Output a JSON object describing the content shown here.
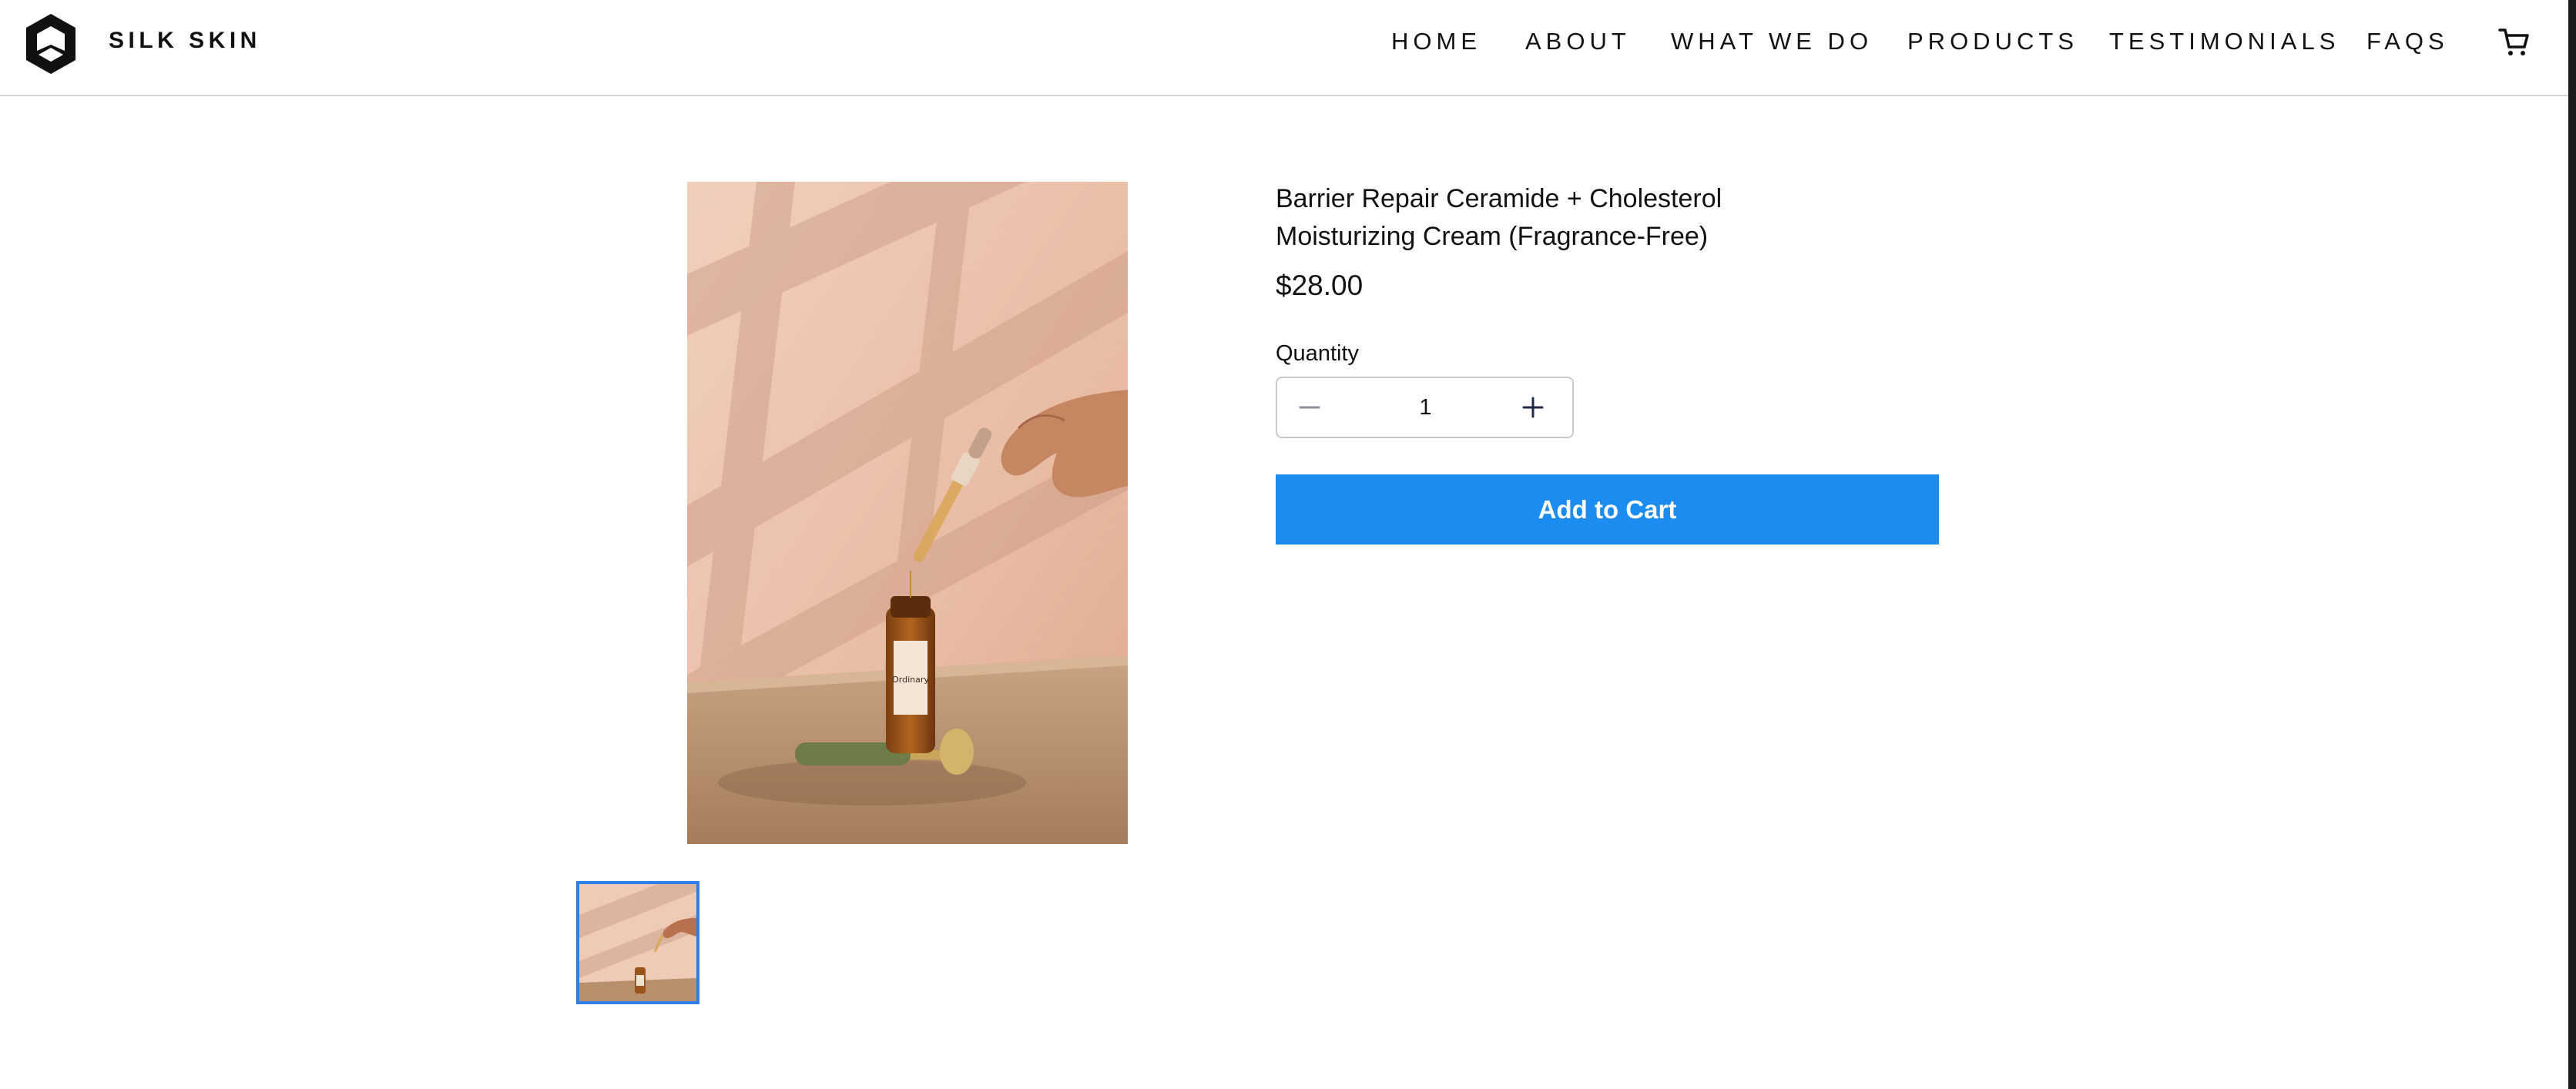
{
  "header": {
    "brand": "SILK SKIN",
    "nav": [
      {
        "label": "HOME",
        "name": "nav-home"
      },
      {
        "label": "ABOUT",
        "name": "nav-about"
      },
      {
        "label": "WHAT WE DO",
        "name": "nav-what-we-do"
      },
      {
        "label": "PRODUCTS",
        "name": "nav-products"
      },
      {
        "label": "TESTIMONIALS",
        "name": "nav-testimonials"
      },
      {
        "label": "FAQS",
        "name": "nav-faqs"
      }
    ],
    "cart_icon": "shopping-cart-icon"
  },
  "product": {
    "title_line1": "Barrier Repair Ceramide + Cholesterol",
    "title_line2": "Moisturizing Cream (Fragrance-Free)",
    "price": "$28.00",
    "quantity_label": "Quantity",
    "quantity_value": "1",
    "add_to_cart_label": "Add to Cart",
    "image_icon": "serum-dropper-photo",
    "thumbnail_icon": "serum-dropper-thumbnail"
  },
  "colors": {
    "accent": "#1d8cf0",
    "thumbnail_border": "#2f7fe9",
    "text": "#111111"
  }
}
